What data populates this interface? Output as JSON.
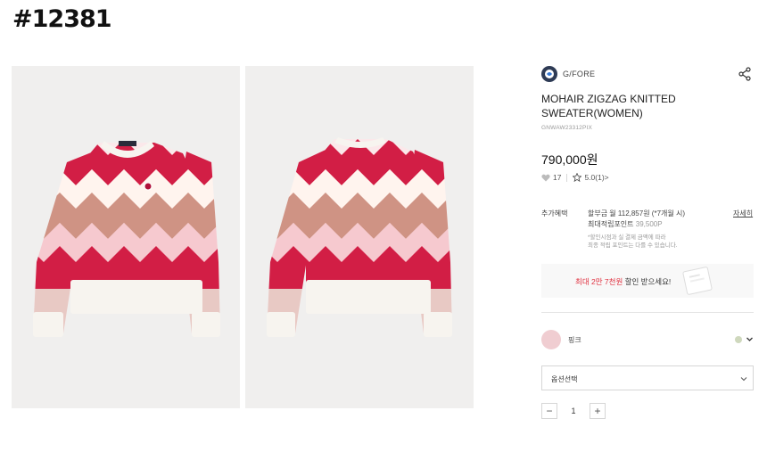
{
  "page_tag": "#12381",
  "product": {
    "brand": "G/FORE",
    "title": "MOHAIR ZIGZAG KNITTED SWEATER(WOMEN)",
    "code": "GNWAW23312PIX",
    "price": "790,000원",
    "likes": "17",
    "rating": "5.0(1)>"
  },
  "benefits": {
    "label": "추가혜택",
    "installment": "할부금 월 112,857원 (*7개월 시)",
    "points_label": "최대적립포인트",
    "points_value": "39,500P",
    "note_line1": "*할인시점과 실 결제 금액에 따라",
    "note_line2": "최종 적립 포인트는 다를 수 있습니다.",
    "detail_link": "자세히"
  },
  "coupon": {
    "highlight": "최대 2만 7천원",
    "text": " 할인 받으세요!"
  },
  "options": {
    "color_name": "핑크",
    "select_placeholder": "옵션선택",
    "quantity": "1",
    "minus": "−",
    "plus": "+"
  },
  "colors": {
    "swatch_pink": "#f0cdd1",
    "swatch_green": "#cfd8bd",
    "sale_red": "#e0303f"
  },
  "icons": {
    "share": "share-icon",
    "heart": "heart-icon",
    "star": "star-icon",
    "chevron": "chevron-down-icon"
  }
}
